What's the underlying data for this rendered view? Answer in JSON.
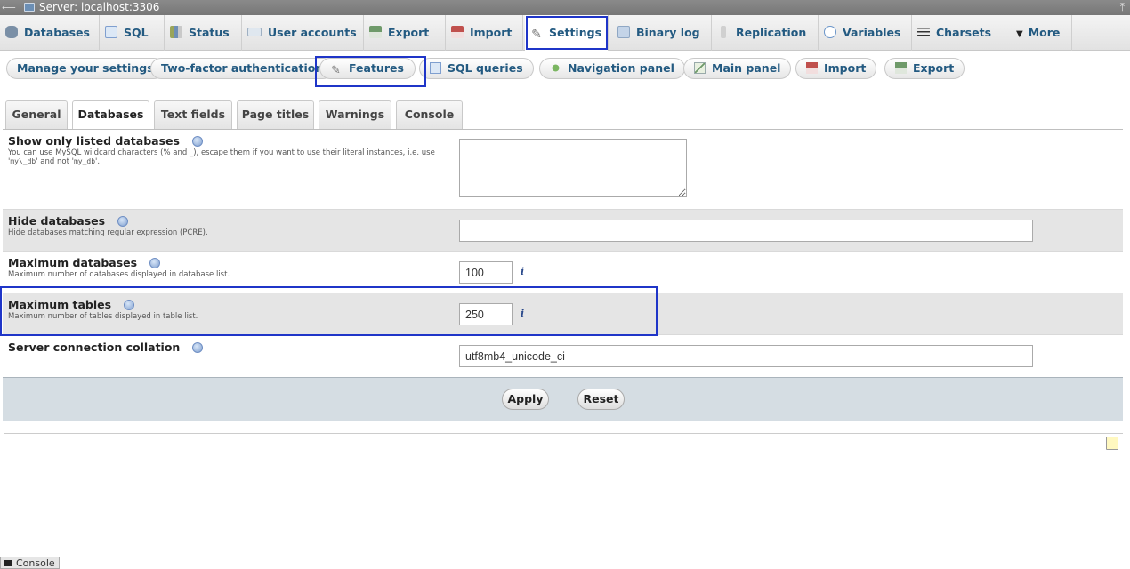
{
  "server_bar": {
    "title": "Server: localhost:3306"
  },
  "topnav": {
    "tabs": [
      {
        "label": "Databases",
        "icon": "database-icon",
        "color": "#7a8fa6"
      },
      {
        "label": "SQL",
        "icon": "sql-icon",
        "color": "#8fb0d8"
      },
      {
        "label": "Status",
        "icon": "status-icon",
        "color": "#9aa55a"
      },
      {
        "label": "User accounts",
        "icon": "users-icon",
        "color": "#b9c6d6"
      },
      {
        "label": "Export",
        "icon": "export-icon",
        "color": "#6f9a6a"
      },
      {
        "label": "Import",
        "icon": "import-icon",
        "color": "#c0504d"
      },
      {
        "label": "Settings",
        "icon": "wrench-icon",
        "color": "#8a8a8a"
      },
      {
        "label": "Binary log",
        "icon": "binary-log-icon",
        "color": "#8fa7c4"
      },
      {
        "label": "Replication",
        "icon": "replication-icon",
        "color": "#c7c7c7"
      },
      {
        "label": "Variables",
        "icon": "variables-icon",
        "color": "#6a95c9"
      },
      {
        "label": "Charsets",
        "icon": "charsets-icon",
        "color": "#333333"
      },
      {
        "label": "More",
        "icon": "triangle-down-icon",
        "color": "#222222"
      }
    ],
    "active": "Settings"
  },
  "subnav": {
    "pills": [
      {
        "label": "Manage your settings"
      },
      {
        "label": "Two-factor authentication"
      },
      {
        "label": "Features",
        "icon": "wrench-icon"
      },
      {
        "label": "SQL queries",
        "icon": "sql-icon"
      },
      {
        "label": "Navigation panel",
        "icon": "navigation-icon"
      },
      {
        "label": "Main panel",
        "icon": "main-panel-icon"
      },
      {
        "label": "Import",
        "icon": "import-icon"
      },
      {
        "label": "Export",
        "icon": "export-icon"
      }
    ],
    "active": "Features"
  },
  "page_tabs": [
    "General",
    "Databases",
    "Text fields",
    "Page titles",
    "Warnings",
    "Console"
  ],
  "page_tab_active": "Databases",
  "settings": {
    "show_only_listed": {
      "name": "Show only listed databases",
      "desc_part1": "You can use MySQL wildcard characters (% and _), escape them if you want to use their literal instances, i.e. use '",
      "desc_code1": "my\\_db",
      "desc_part2": "' and not '",
      "desc_code2": "my_db",
      "desc_part3": "'.",
      "value": ""
    },
    "hide_databases": {
      "name": "Hide databases",
      "desc": "Hide databases matching regular expression (PCRE).",
      "value": ""
    },
    "max_databases": {
      "name": "Maximum databases",
      "desc": "Maximum number of databases displayed in database list.",
      "value": "100"
    },
    "max_tables": {
      "name": "Maximum tables",
      "desc": "Maximum number of tables displayed in table list.",
      "value": "250"
    },
    "server_collation": {
      "name": "Server connection collation",
      "value": "utf8mb4_unicode_ci"
    },
    "info_glyph": "i"
  },
  "buttons": {
    "apply": "Apply",
    "reset": "Reset"
  },
  "console": {
    "label": "Console"
  },
  "colors": {
    "link": "#235a81",
    "highlight": "#1f35c8",
    "footer_bg": "#d5dde3"
  }
}
